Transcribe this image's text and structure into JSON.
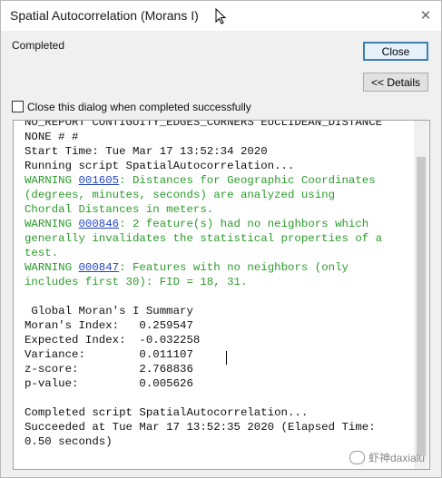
{
  "window": {
    "title": "Spatial Autocorrelation (Morans I)",
    "close_glyph": "✕"
  },
  "status": {
    "text": "Completed"
  },
  "buttons": {
    "close_label": "Close",
    "details_label": "<< Details"
  },
  "checkbox": {
    "label": "Close this dialog when completed successfully",
    "checked": false
  },
  "log": {
    "lines": [
      {
        "text": "NO_REPORT CONTIGUITY_EDGES_CORNERS EUCLIDEAN_DISTANCE"
      },
      {
        "text": "NONE # #"
      },
      {
        "text": "Start Time: Tue Mar 17 13:52:34 2020"
      },
      {
        "text": "Running script SpatialAutocorrelation..."
      },
      {
        "text": "WARNING ",
        "link": "001605",
        "after": ": Distances for Geographic Coordinates",
        "style": "warning"
      },
      {
        "text": "(degrees, minutes, seconds) are analyzed using",
        "style": "warning"
      },
      {
        "text": "Chordal Distances in meters.",
        "style": "warning"
      },
      {
        "text": "WARNING ",
        "link": "000846",
        "after": ": 2 feature(s) had no neighbors which",
        "style": "warning"
      },
      {
        "text": "generally invalidates the statistical properties of a",
        "style": "warning"
      },
      {
        "text": "test.",
        "style": "warning"
      },
      {
        "text": "WARNING ",
        "link": "000847",
        "after": ": Features with no neighbors (only",
        "style": "warning"
      },
      {
        "text": "includes first 30): FID = 18, 31.",
        "style": "warning"
      },
      {
        "text": ""
      },
      {
        "text": " Global Moran's I Summary"
      },
      {
        "text": "Moran's Index:   0.259547"
      },
      {
        "text": "Expected Index:  -0.032258"
      },
      {
        "text": "Variance:        0.011107"
      },
      {
        "text": "z-score:         2.768836"
      },
      {
        "text": "p-value:         0.005626"
      },
      {
        "text": ""
      },
      {
        "text": "Completed script SpatialAutocorrelation..."
      },
      {
        "text": "Succeeded at Tue Mar 17 13:52:35 2020 (Elapsed Time:"
      },
      {
        "text": "0.50 seconds)"
      }
    ]
  },
  "watermark": {
    "text": "虾神daxialu"
  },
  "colors": {
    "warning": "#2b9b2b",
    "link": "#2345c4",
    "focus_border": "#3c7fb1"
  }
}
